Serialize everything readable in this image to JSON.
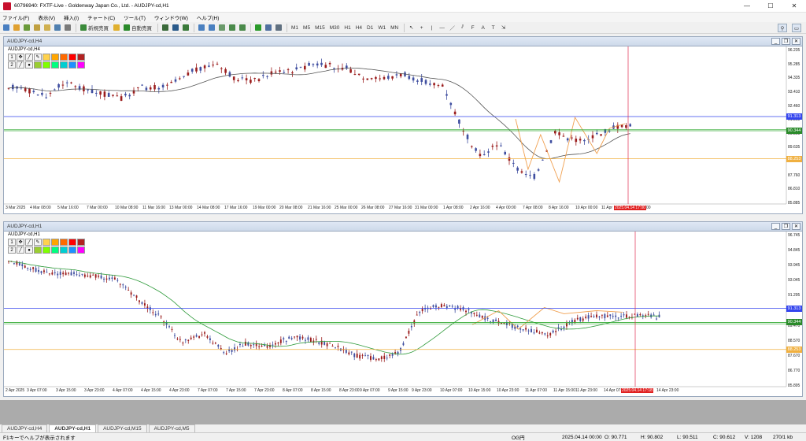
{
  "window": {
    "title": "60796940: FXTF-Live - Goldenway Japan Co., Ltd. - AUDJPY-cd,H1",
    "minimize": "—",
    "maximize": "☐",
    "close": "✕"
  },
  "menu": [
    "ファイル(F)",
    "表示(V)",
    "挿入(I)",
    "チャート(C)",
    "ツール(T)",
    "ウィンドウ(W)",
    "ヘルプ(H)"
  ],
  "toolbar": {
    "new_order": "新規売買",
    "auto_trade": "自動売買",
    "timeframes": [
      "M1",
      "M5",
      "M15",
      "M30",
      "H1",
      "H4",
      "D1",
      "W1",
      "MN"
    ],
    "search_icon": "magnifier-icon",
    "arrow_icon": "arrow-icon"
  },
  "chart_top": {
    "window_caption": "AUDJPY-cd,H4",
    "symbol_label": "AUDJPY-cd,H4",
    "y_ticks": [
      "96.235",
      "95.285",
      "94.335",
      "93.410",
      "92.460",
      "91.310",
      "90.560",
      "89.635",
      "88.710",
      "87.760",
      "86.810",
      "85.885"
    ],
    "x_ticks": [
      "3 Mar 2025",
      "4 Mar 08:00",
      "5 Mar 16:00",
      "7 Mar 00:00",
      "10 Mar 08:00",
      "11 Mar 16:00",
      "13 Mar 00:00",
      "14 Mar 08:00",
      "17 Mar 16:00",
      "19 Mar 00:00",
      "20 Mar 08:00",
      "21 Mar 16:00",
      "25 Mar 00:00",
      "26 Mar 08:00",
      "27 Mar 16:00",
      "31 Mar 00:00",
      "1 Apr 08:00",
      "2 Apr 16:00",
      "4 Apr 00:00",
      "7 Apr 08:00",
      "8 Apr 16:00",
      "10 Apr 00:00",
      "11 Apr"
    ],
    "crosshair_time": "2025.04.14 17:00",
    "crosshair_time_after": "00",
    "tag_blue": "91.313",
    "tag_green": "90.344",
    "tag_orange": "88.253"
  },
  "chart_bottom": {
    "window_caption": "AUDJPY-cd,H1",
    "symbol_label": "AUDJPY-cd,H1",
    "y_ticks": [
      "96.745",
      "94.845",
      "93.945",
      "93.045",
      "91.295",
      "90.395",
      "89.470",
      "88.570",
      "87.670",
      "86.770",
      "85.895"
    ],
    "x_ticks": [
      "2 Apr 2025",
      "3 Apr 07:00",
      "3 Apr 15:00",
      "3 Apr 23:00",
      "4 Apr 07:00",
      "4 Apr 15:00",
      "4 Apr 23:00",
      "7 Apr 07:00",
      "7 Apr 15:00",
      "7 Apr 23:00",
      "8 Apr 07:00",
      "8 Apr 15:00",
      "8 Apr 23:00",
      "9 Apr 07:00",
      "9 Apr 15:00",
      "9 Apr 23:00",
      "10 Apr 07:00",
      "10 Apr 15:00",
      "10 Apr 23:00",
      "11 Apr 07:00",
      "11 Apr 15:00",
      "11 Apr 23:00",
      "14 Apr 07:00",
      "14 Apr 23:00"
    ],
    "crosshair_time": "2025.04.14 17:18",
    "tag_blue": "91.313",
    "tag_green": "90.344",
    "tag_orange": "88.253"
  },
  "palette": {
    "colors": [
      "#ffd24d",
      "#ffa500",
      "#ff6a00",
      "#ff0000",
      "#b22222",
      "#800000",
      "#9acd32",
      "#7fff00",
      "#00ff7f",
      "#00ced1",
      "#1e90ff",
      "#ff00ff",
      "#00c000",
      "#00ffff"
    ],
    "row_labels": [
      "1",
      "2"
    ]
  },
  "tabs": [
    "AUDJPY-cd,H4",
    "AUDJPY-cd,H1",
    "AUDJPY-cd,M15",
    "AUDJPY-cd,M5"
  ],
  "active_tab": 1,
  "status": {
    "help": "F1キーでヘルプが表示されます",
    "profile": "OG円",
    "datetime": "2025.04.14 00:00",
    "open": "O: 90.771",
    "high": "H: 90.802",
    "low": "L: 90.511",
    "close": "C: 90.612",
    "volume": "V: 1208",
    "traffic": "270/1 kb"
  },
  "colors": {
    "bull": "#3f4ea0",
    "bear": "#9b1d1d",
    "ma_top": "#555555",
    "ma_bottom": "#2e9a3a",
    "zigzag": "#f0a050",
    "line_blue": "#3344ee",
    "line_green": "#33aa33",
    "line_orange": "#f0b040",
    "crosshair": "#e03050"
  }
}
